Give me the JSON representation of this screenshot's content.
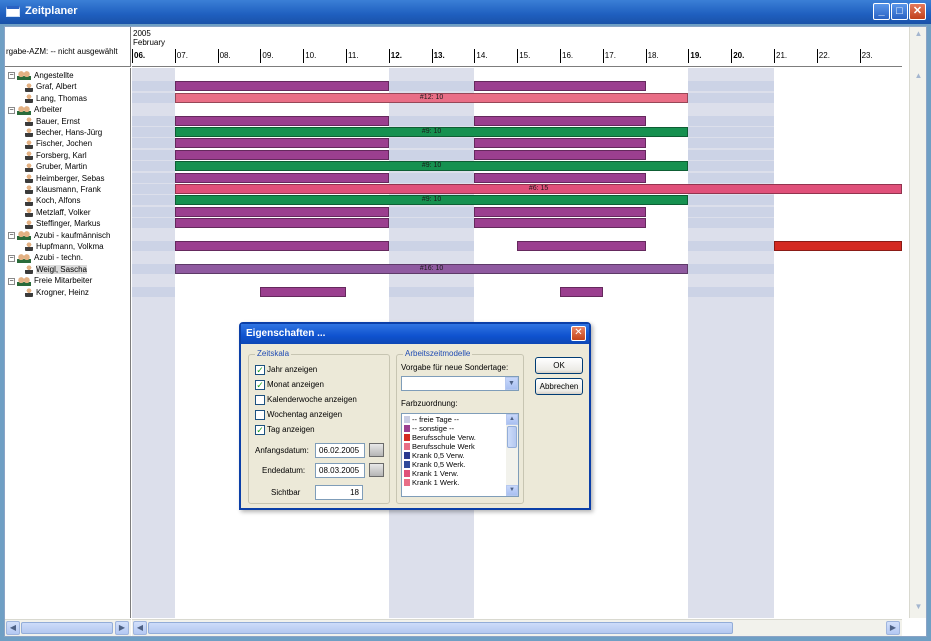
{
  "window": {
    "title": "Zeitplaner",
    "min": "_",
    "max": "□",
    "close": "✕"
  },
  "header": {
    "left_label": "rgabe-AZM: -- nicht ausgewählt",
    "year": "2005",
    "month": "February",
    "days": [
      {
        "label": "06.",
        "bold": true
      },
      {
        "label": "07.",
        "bold": false
      },
      {
        "label": "08.",
        "bold": false
      },
      {
        "label": "09.",
        "bold": false
      },
      {
        "label": "10.",
        "bold": false
      },
      {
        "label": "11.",
        "bold": false
      },
      {
        "label": "12.",
        "bold": true
      },
      {
        "label": "13.",
        "bold": true
      },
      {
        "label": "14.",
        "bold": false
      },
      {
        "label": "15.",
        "bold": false
      },
      {
        "label": "16.",
        "bold": false
      },
      {
        "label": "17.",
        "bold": false
      },
      {
        "label": "18.",
        "bold": false
      },
      {
        "label": "19.",
        "bold": true
      },
      {
        "label": "20.",
        "bold": true
      },
      {
        "label": "21.",
        "bold": false
      },
      {
        "label": "22.",
        "bold": false
      },
      {
        "label": "23.",
        "bold": false
      }
    ]
  },
  "tree": [
    {
      "label": "Angestellte",
      "type": "group"
    },
    {
      "label": "Graf, Albert",
      "type": "person"
    },
    {
      "label": "Lang, Thomas",
      "type": "person"
    },
    {
      "label": "Arbeiter",
      "type": "group"
    },
    {
      "label": "Bauer, Ernst",
      "type": "person"
    },
    {
      "label": "Becher, Hans-Jürg",
      "type": "person"
    },
    {
      "label": "Fischer, Jochen",
      "type": "person"
    },
    {
      "label": "Forsberg, Karl",
      "type": "person"
    },
    {
      "label": "Gruber, Martin",
      "type": "person"
    },
    {
      "label": "Heimberger, Sebas",
      "type": "person"
    },
    {
      "label": "Klausmann, Frank",
      "type": "person"
    },
    {
      "label": "Koch, Alfons",
      "type": "person"
    },
    {
      "label": "Metzlaff, Volker",
      "type": "person"
    },
    {
      "label": "Steffinger, Markus",
      "type": "person"
    },
    {
      "label": "Azubi - kaufmännisch",
      "type": "group"
    },
    {
      "label": "Hupfmann, Volkma",
      "type": "person"
    },
    {
      "label": "Azubi - techn.",
      "type": "group"
    },
    {
      "label": "Weigl, Sascha",
      "type": "person",
      "selected": true
    },
    {
      "label": "Freie Mitarbeiter",
      "type": "group"
    },
    {
      "label": "Krogner, Heinz",
      "type": "person"
    }
  ],
  "bars": [
    {
      "row": 1,
      "start": 1,
      "end": 6,
      "color": "#9b3f8f",
      "label": ""
    },
    {
      "row": 1,
      "start": 8,
      "end": 12,
      "color": "#9b3f8f",
      "label": ""
    },
    {
      "row": 2,
      "start": 1,
      "end": 13,
      "color": "#e96e86",
      "label": "#12: 10"
    },
    {
      "row": 4,
      "start": 1,
      "end": 6,
      "color": "#9b3f8f",
      "label": ""
    },
    {
      "row": 4,
      "start": 8,
      "end": 12,
      "color": "#9b3f8f",
      "label": ""
    },
    {
      "row": 5,
      "start": 1,
      "end": 13,
      "color": "#169150",
      "label": "#9: 10"
    },
    {
      "row": 6,
      "start": 1,
      "end": 6,
      "color": "#9b3f8f",
      "label": ""
    },
    {
      "row": 6,
      "start": 8,
      "end": 12,
      "color": "#9b3f8f",
      "label": ""
    },
    {
      "row": 7,
      "start": 1,
      "end": 6,
      "color": "#9b3f8f",
      "label": ""
    },
    {
      "row": 7,
      "start": 8,
      "end": 12,
      "color": "#9b3f8f",
      "label": ""
    },
    {
      "row": 8,
      "start": 1,
      "end": 13,
      "color": "#169150",
      "label": "#9: 10"
    },
    {
      "row": 9,
      "start": 1,
      "end": 6,
      "color": "#9b3f8f",
      "label": ""
    },
    {
      "row": 9,
      "start": 8,
      "end": 12,
      "color": "#9b3f8f",
      "label": ""
    },
    {
      "row": 10,
      "start": 1,
      "end": 18,
      "color": "#e0507a",
      "label": "#6: 15"
    },
    {
      "row": 11,
      "start": 1,
      "end": 13,
      "color": "#169150",
      "label": "#9: 10"
    },
    {
      "row": 12,
      "start": 1,
      "end": 6,
      "color": "#9b3f8f",
      "label": ""
    },
    {
      "row": 12,
      "start": 8,
      "end": 12,
      "color": "#9b3f8f",
      "label": ""
    },
    {
      "row": 13,
      "start": 1,
      "end": 6,
      "color": "#9b3f8f",
      "label": ""
    },
    {
      "row": 13,
      "start": 8,
      "end": 12,
      "color": "#9b3f8f",
      "label": ""
    },
    {
      "row": 15,
      "start": 1,
      "end": 6,
      "color": "#9b3f8f",
      "label": ""
    },
    {
      "row": 15,
      "start": 9,
      "end": 12,
      "color": "#9b3f8f",
      "label": ""
    },
    {
      "row": 15,
      "start": 15,
      "end": 18,
      "color": "#d42a22",
      "label": ""
    },
    {
      "row": 17,
      "start": 1,
      "end": 13,
      "color": "#8f5aa0",
      "label": "#16: 10"
    },
    {
      "row": 19,
      "start": 3,
      "end": 5,
      "color": "#9b3f8f",
      "label": ""
    },
    {
      "row": 19,
      "start": 10,
      "end": 11,
      "color": "#9b3f8f",
      "label": ""
    }
  ],
  "dialog": {
    "title": "Eigenschaften ...",
    "zeitskala": {
      "legend": "Zeitskala",
      "jahr": {
        "label": "Jahr anzeigen",
        "checked": true
      },
      "monat": {
        "label": "Monat anzeigen",
        "checked": true
      },
      "kw": {
        "label": "Kalenderwoche anzeigen",
        "checked": false
      },
      "wochentag": {
        "label": "Wochentag anzeigen",
        "checked": false
      },
      "tag": {
        "label": "Tag anzeigen",
        "checked": true
      },
      "anfangsdatum_label": "Anfangsdatum:",
      "anfangsdatum": "06.02.2005",
      "endedatum_label": "Endedatum:",
      "endedatum": "08.03.2005",
      "sichtbar_label": "Sichtbar",
      "sichtbar": "18"
    },
    "arbeitszeit": {
      "legend": "Arbeitszeitmodelle",
      "vorgabe_label": "Vorgabe für neue Sondertage:",
      "vorgabe_value": "",
      "farb_label": "Farbzuordnung:",
      "items": [
        {
          "label": "-- freie Tage --",
          "color": "#c9cde3"
        },
        {
          "label": "-- sonstige --",
          "color": "#9b3f8f"
        },
        {
          "label": "Berufsschule Verw.",
          "color": "#d42a22"
        },
        {
          "label": "Berufsschule Werk",
          "color": "#e96e86"
        },
        {
          "label": "Krank 0,5 Verw.",
          "color": "#2a3a8f"
        },
        {
          "label": "Krank 0,5 Werk.",
          "color": "#2f4a9a"
        },
        {
          "label": "Krank 1 Verw.",
          "color": "#e0507a"
        },
        {
          "label": "Krank 1 Werk.",
          "color": "#e96e86"
        }
      ]
    },
    "ok": "OK",
    "cancel": "Abbrechen"
  }
}
